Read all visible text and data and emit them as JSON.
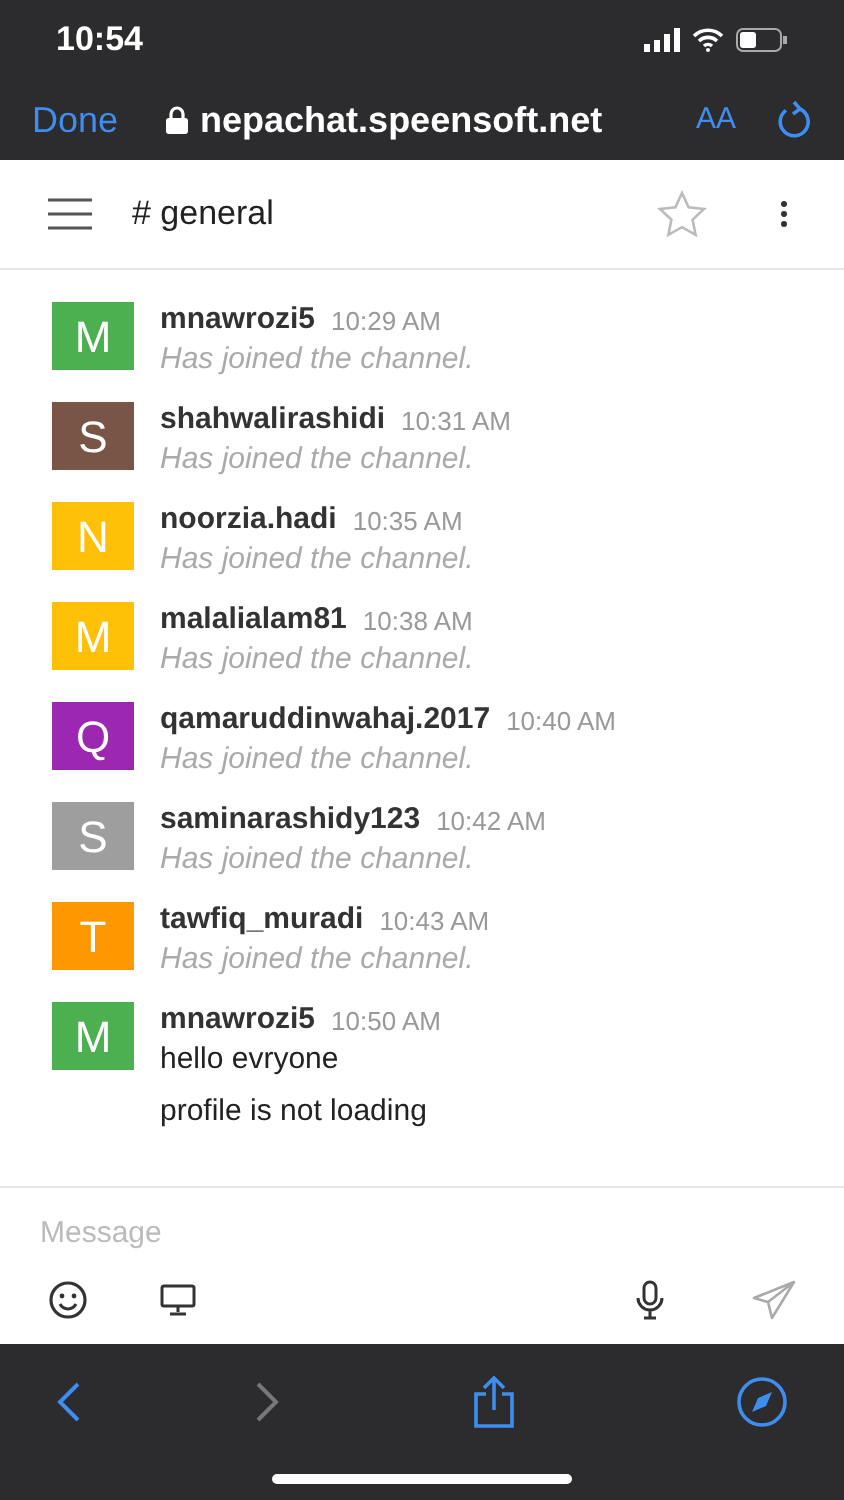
{
  "status_bar": {
    "time": "10:54"
  },
  "browser_bar": {
    "done": "Done",
    "url": "nepachat.speensoft.net",
    "text_size": "AA"
  },
  "channel_header": {
    "title": "# general",
    "starred": false
  },
  "messages": [
    {
      "avatar": "M",
      "color": "#4caf50",
      "name": "mnawrozi5",
      "time": "10:29 AM",
      "lines": [
        {
          "kind": "system",
          "text": "Has joined the channel."
        }
      ]
    },
    {
      "avatar": "S",
      "color": "#795548",
      "name": "shahwalirashidi",
      "time": "10:31 AM",
      "lines": [
        {
          "kind": "system",
          "text": "Has joined the channel."
        }
      ]
    },
    {
      "avatar": "N",
      "color": "#ffc107",
      "name": "noorzia.hadi",
      "time": "10:35 AM",
      "lines": [
        {
          "kind": "system",
          "text": "Has joined the channel."
        }
      ]
    },
    {
      "avatar": "M",
      "color": "#ffc107",
      "name": "malalialam81",
      "time": "10:38 AM",
      "lines": [
        {
          "kind": "system",
          "text": "Has joined the channel."
        }
      ]
    },
    {
      "avatar": "Q",
      "color": "#9c27b0",
      "name": "qamaruddinwahaj.2017",
      "time": "10:40 AM",
      "lines": [
        {
          "kind": "system",
          "text": "Has joined the channel."
        }
      ]
    },
    {
      "avatar": "S",
      "color": "#9e9e9e",
      "name": "saminarashidy123",
      "time": "10:42 AM",
      "lines": [
        {
          "kind": "system",
          "text": "Has joined the channel."
        }
      ]
    },
    {
      "avatar": "T",
      "color": "#ff9800",
      "name": "tawfiq_muradi",
      "time": "10:43 AM",
      "lines": [
        {
          "kind": "system",
          "text": "Has joined the channel."
        }
      ]
    },
    {
      "avatar": "M",
      "color": "#4caf50",
      "name": "mnawrozi5",
      "time": "10:50 AM",
      "lines": [
        {
          "kind": "text",
          "text": "hello evryone"
        },
        {
          "kind": "text",
          "text": "profile is not loading"
        }
      ]
    }
  ],
  "composer": {
    "placeholder": "Message"
  },
  "toolbar": {
    "back_disabled": false,
    "forward_disabled": true
  }
}
